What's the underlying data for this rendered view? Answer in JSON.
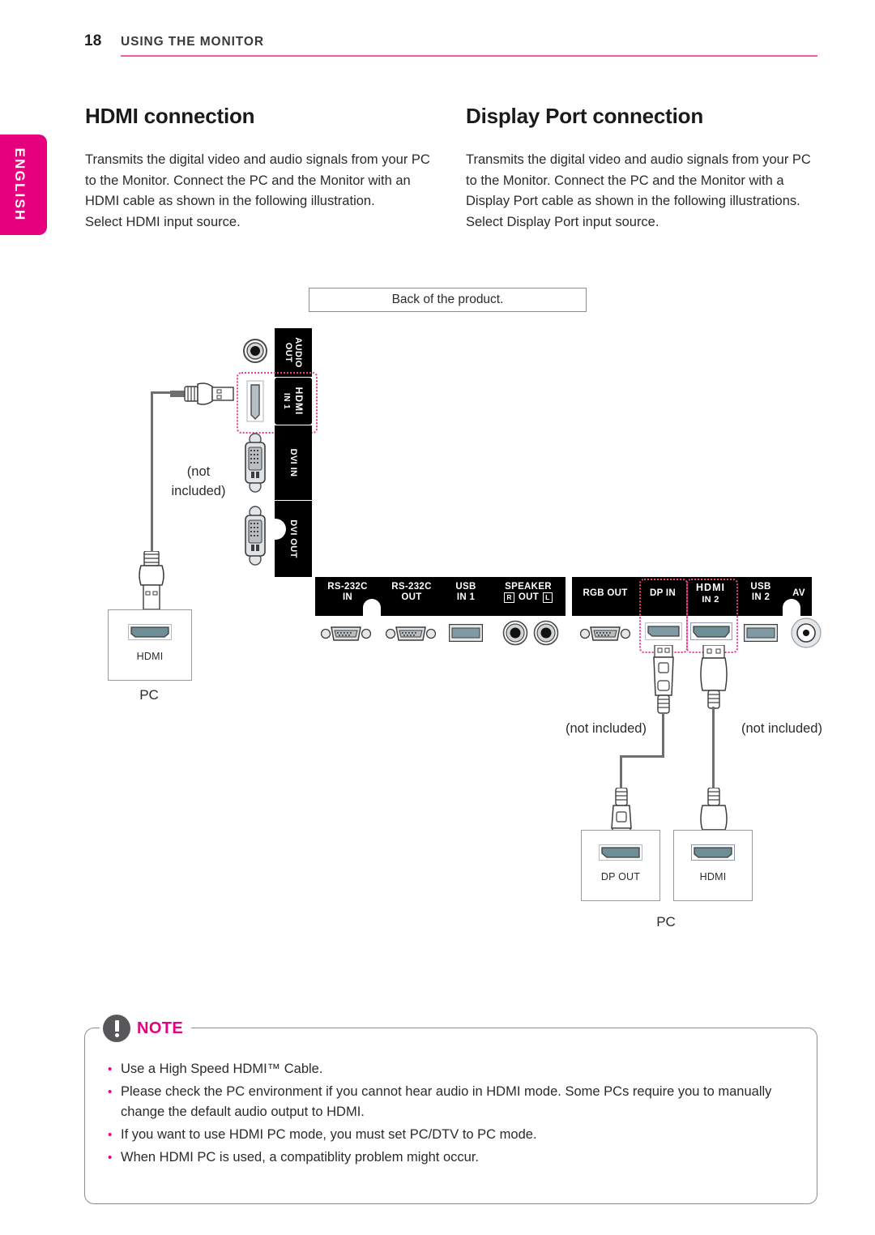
{
  "header": {
    "page_number": "18",
    "chapter": "USING THE MONITOR",
    "rule_color": "#ee5ea3"
  },
  "language_tab": {
    "label": "ENGLISH",
    "color": "#e6007e"
  },
  "sections": [
    {
      "id": "hdmi",
      "title": "HDMI connection",
      "body": "Transmits the digital video and audio signals from your PC to the Monitor. Connect the PC and the Monitor with an HDMI cable as shown in the following illustration.\nSelect HDMI input source."
    },
    {
      "id": "displayport",
      "title": "Display Port connection",
      "body": "Transmits the digital video and audio signals from your PC to the Monitor. Connect the PC and the Monitor with a Display Port cable as shown in the following illustrations.\nSelect Display Port input source."
    }
  ],
  "diagram": {
    "caption": "Back of the product.",
    "highlight_color": "#ee3d8f",
    "vertical_ports": [
      {
        "label": "AUDIO OUT",
        "line1": "AUDIO",
        "line2": "OUT",
        "connector": "3.5mm-jack"
      },
      {
        "label": "HDMI IN 1",
        "line1": "HDMI",
        "line2": "IN 1",
        "connector": "hdmi",
        "highlighted": true
      },
      {
        "label": "DVI IN",
        "line1": "DVI IN",
        "line2": "",
        "connector": "dvi"
      },
      {
        "label": "DVI OUT",
        "line1": "DVI OUT",
        "line2": "",
        "connector": "dvi"
      }
    ],
    "horizontal_ports_left": [
      {
        "line1": "RS-232C",
        "line2": "IN",
        "connector": "d-sub"
      },
      {
        "line1": "RS-232C",
        "line2": "OUT",
        "connector": "d-sub"
      },
      {
        "line1": "USB",
        "line2": "IN 1",
        "connector": "usb"
      },
      {
        "line1": "SPEAKER",
        "line2": "OUT",
        "sub_left": "R",
        "sub_right": "L",
        "connector": "speaker-pair"
      }
    ],
    "horizontal_ports_right": [
      {
        "line1": "RGB OUT",
        "line2": "",
        "connector": "d-sub"
      },
      {
        "line1": "DP IN",
        "line2": "",
        "connector": "displayport",
        "highlighted": true
      },
      {
        "line1": "HDMI",
        "line2": "IN 2",
        "connector": "hdmi",
        "highlighted": true
      },
      {
        "line1": "USB",
        "line2": "IN 2",
        "connector": "usb"
      },
      {
        "line1": "AV",
        "line2": "",
        "connector": "rca"
      }
    ],
    "cable_notes": [
      {
        "id": "hdmi-cable-note",
        "text": "(not\nincluded)"
      },
      {
        "id": "dp-cable-note",
        "text": "(not included)"
      },
      {
        "id": "hdmi2-cable-note",
        "text": "(not included)"
      }
    ],
    "pc_devices": [
      {
        "id": "pc-left",
        "port_label": "HDMI",
        "caption": "PC"
      },
      {
        "id": "pc-right-dp",
        "port_label": "DP OUT",
        "caption": "PC"
      },
      {
        "id": "pc-right-hdmi",
        "port_label": "HDMI",
        "caption": ""
      }
    ],
    "pc_caption": "PC"
  },
  "note": {
    "label": "NOTE",
    "icon": "exclamation-circle-icon",
    "accent_color": "#e6007e",
    "items": [
      "Use a High Speed HDMI™ Cable.",
      "Please check the PC environment if you cannot hear audio in HDMI mode. Some PCs require you to manually change the default audio output to HDMI.",
      "If you want to use HDMI PC mode, you must set PC/DTV to PC mode.",
      "When HDMI PC is used, a compatiblity problem might occur."
    ]
  }
}
